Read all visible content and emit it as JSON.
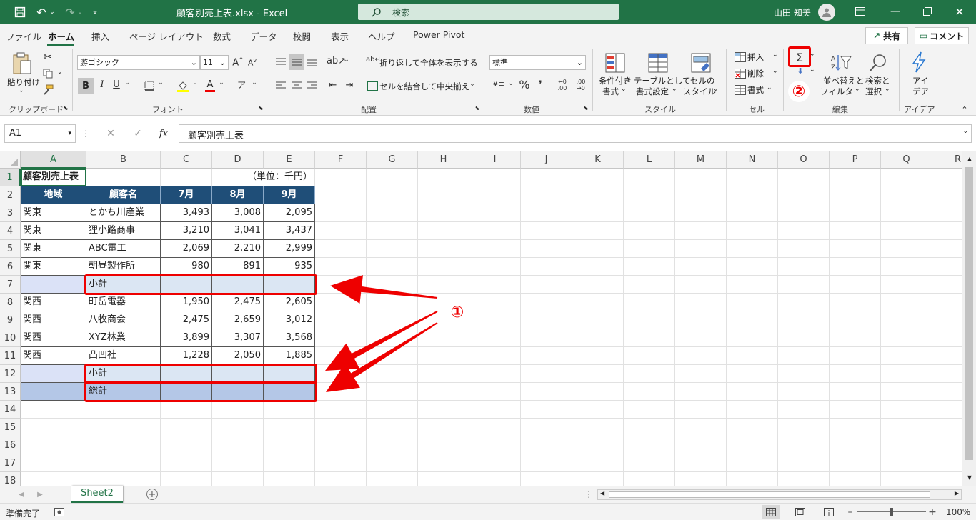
{
  "titlebar": {
    "title": "顧客別売上表.xlsx  -  Excel",
    "search_placeholder": "検索",
    "user": "山田 知美"
  },
  "tabs": [
    "ファイル",
    "ホーム",
    "挿入",
    "ページ レイアウト",
    "数式",
    "データ",
    "校閲",
    "表示",
    "ヘルプ",
    "Power Pivot"
  ],
  "share_label": "共有",
  "comment_label": "コメント",
  "ribbon": {
    "clipboard": {
      "paste": "貼り付け",
      "group": "クリップボード"
    },
    "font": {
      "name": "游ゴシック",
      "size": "11",
      "group": "フォント"
    },
    "alignment": {
      "wrap": "折り返して全体を表示する",
      "merge": "セルを結合して中央揃え",
      "group": "配置"
    },
    "number": {
      "format": "標準",
      "group": "数値"
    },
    "styles": {
      "cond": "条件付き",
      "cond2": "書式",
      "table": "テーブルとして",
      "table2": "書式設定",
      "cell": "セルの",
      "cell2": "スタイル",
      "group": "スタイル"
    },
    "cells": {
      "insert": "挿入",
      "delete": "削除",
      "format": "書式",
      "group": "セル"
    },
    "editing": {
      "sort": "並べ替えと",
      "sort2": "フィルター",
      "find": "検索と",
      "find2": "選択",
      "group": "編集"
    },
    "ideas": {
      "l1": "アイ",
      "l2": "デア",
      "group": "アイデア"
    }
  },
  "formula": {
    "namebox": "A1",
    "content": "顧客別売上表"
  },
  "columns": [
    "A",
    "B",
    "C",
    "D",
    "E",
    "F",
    "G",
    "H",
    "I",
    "J",
    "K",
    "L",
    "M",
    "N",
    "O",
    "P",
    "Q",
    "R"
  ],
  "rows": [
    "1",
    "2",
    "3",
    "4",
    "5",
    "6",
    "7",
    "8",
    "9",
    "10",
    "11",
    "12",
    "13",
    "14",
    "15",
    "16",
    "17",
    "18"
  ],
  "table": {
    "title": "顧客別売上表",
    "unit": "（単位：千円）",
    "headers": [
      "地域",
      "顧客名",
      "7月",
      "8月",
      "9月"
    ],
    "body": [
      [
        "関東",
        "とかち川産業",
        "3,493",
        "3,008",
        "2,095"
      ],
      [
        "関東",
        "狸小路商事",
        "3,210",
        "3,041",
        "3,437"
      ],
      [
        "関東",
        "ABC電工",
        "2,069",
        "2,210",
        "2,999"
      ],
      [
        "関東",
        "朝昼製作所",
        "980",
        "891",
        "935"
      ],
      [
        "",
        "小計",
        "",
        "",
        ""
      ],
      [
        "関西",
        "町岳電器",
        "1,950",
        "2,475",
        "2,605"
      ],
      [
        "関西",
        "八牧商会",
        "2,475",
        "2,659",
        "3,012"
      ],
      [
        "関西",
        "XYZ林業",
        "3,899",
        "3,307",
        "3,568"
      ],
      [
        "関西",
        "凸凹社",
        "1,228",
        "2,050",
        "1,885"
      ],
      [
        "",
        "小計",
        "",
        "",
        ""
      ],
      [
        "",
        "総計",
        "",
        "",
        ""
      ]
    ]
  },
  "annotations": {
    "one": "①",
    "two": "②"
  },
  "sheet_tab": "Sheet2",
  "status": {
    "ready": "準備完了",
    "zoom": "100%"
  },
  "colors": {
    "excel_green": "#217346",
    "header_fill": "#1f4e78",
    "subtotal_fill": "#dbe6f3",
    "total_fill": "#b4c7e7",
    "annotation_red": "#ee0000"
  }
}
